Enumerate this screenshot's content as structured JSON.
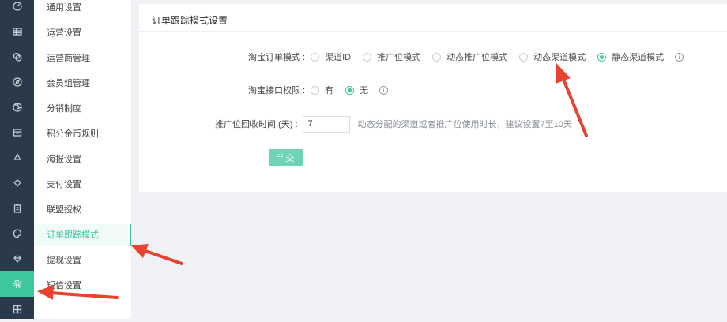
{
  "sidebar_icons": [
    "speedometer-icon",
    "table-icon",
    "coins-icon",
    "compass-icon",
    "aperture-icon",
    "archive-icon",
    "recycle-icon",
    "diamond-icon",
    "clipboard-icon",
    "palette-icon",
    "gem-icon",
    "settings-icon",
    "grid-icon"
  ],
  "submenu": {
    "items": [
      "通用设置",
      "运营设置",
      "运营商管理",
      "会员组管理",
      "分销制度",
      "积分金币规则",
      "海报设置",
      "支付设置",
      "联盟授权",
      "订单跟踪模式",
      "提现设置",
      "短信设置"
    ],
    "active_index": 9
  },
  "card": {
    "title": "订单跟踪模式设置",
    "order_mode": {
      "label": "淘宝订单模式 :",
      "options": [
        "渠道ID",
        "推广位模式",
        "动态推广位模式",
        "动态渠道模式",
        "静态渠道模式"
      ],
      "selected": "静态渠道模式"
    },
    "api_permission": {
      "label": "淘宝接口权限 :",
      "options": [
        "有",
        "无"
      ],
      "selected": "无"
    },
    "recycle_time": {
      "label": "推广位回收时间 (天) :",
      "value": "7",
      "hint": "动态分配的渠道或者推广位使用时长，建议设置7至10天"
    },
    "submit_label": "交",
    "submit_glyph": "☷"
  },
  "colors": {
    "accent": "#3fc7a0",
    "sidebar_bg": "#2b3a4a",
    "arrow": "#e8432e"
  }
}
